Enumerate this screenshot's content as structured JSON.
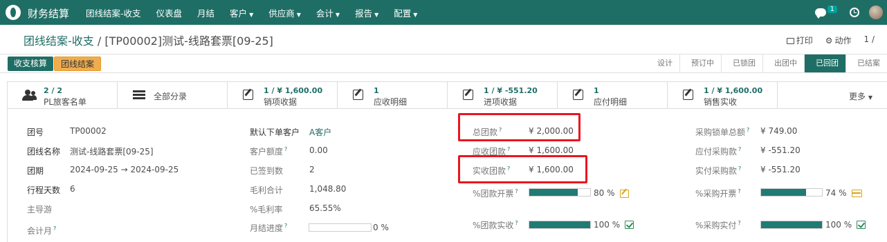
{
  "app": {
    "brand": "财务结算"
  },
  "nav": {
    "items": [
      {
        "label": "团线结案-收支",
        "dropdown": false
      },
      {
        "label": "仪表盘",
        "dropdown": false
      },
      {
        "label": "月结",
        "dropdown": false
      },
      {
        "label": "客户",
        "dropdown": true
      },
      {
        "label": "供应商",
        "dropdown": true
      },
      {
        "label": "会计",
        "dropdown": true
      },
      {
        "label": "报告",
        "dropdown": true
      },
      {
        "label": "配置",
        "dropdown": true
      }
    ],
    "message_count": "1"
  },
  "breadcrumb": {
    "parent": "团线结案-收支",
    "separator": "/",
    "current": "[TP00002]测试-线路套票[09-25]"
  },
  "actions": {
    "print": "打印",
    "action": "动作",
    "pager": "1 /"
  },
  "statusbar": {
    "buttons": [
      "收支核算",
      "团线结案"
    ],
    "stages": [
      "设计",
      "预订中",
      "已锁团",
      "出团中",
      "已回团",
      "已结案"
    ],
    "active_stage": "已回团"
  },
  "smart_buttons": [
    {
      "line1": "2 / 2",
      "line2": "PL旅客名单",
      "icon": "users-icon"
    },
    {
      "line1": "",
      "line2": "全部分录",
      "icon": "list-icon"
    },
    {
      "line1": "1 / ¥ 1,600.00",
      "line2": "销项收据",
      "icon": "edit-icon"
    },
    {
      "line1": "1",
      "line2": "应收明细",
      "icon": "edit-icon"
    },
    {
      "line1": "1 / ¥ -551.20",
      "line2": "进项收据",
      "icon": "edit-icon"
    },
    {
      "line1": "1",
      "line2": "应付明细",
      "icon": "edit-icon"
    },
    {
      "line1": "1 / ¥ 1,600.00",
      "line2": "销售实收",
      "icon": "edit-icon"
    },
    {
      "line1": "",
      "line2": "更多",
      "icon": "caret-down-icon"
    }
  ],
  "col1": {
    "group_no_label": "团号",
    "group_no": "TP00002",
    "group_name_label": "团线名称",
    "group_name": "测试-线路套票[09-25]",
    "period_label": "团期",
    "date_from": "2024-09-25",
    "arrow": "→",
    "date_to": "2024-09-25",
    "days_label": "行程天数",
    "days": "6",
    "guide_label": "主导游",
    "month_label": "会计月"
  },
  "col2": {
    "customer_label": "默认下单客户",
    "customer": "A客户",
    "credit_label": "客户额度",
    "credit": "0.00",
    "signed_label": "已签到数",
    "signed": "2",
    "gross_label": "毛利合计",
    "gross": "1,048.80",
    "margin_label": "%毛利率",
    "margin": "65.55%",
    "month_progress_label": "月结进度",
    "month_progress": "0 %",
    "month_progress_value": 0
  },
  "col3": {
    "total_label": "总团款",
    "total": "¥ 2,000.00",
    "receivable_label": "应收团款",
    "receivable": "¥ 1,600.00",
    "received_label": "实收团款",
    "received": "¥ 1,600.00",
    "invoice_label": "%团款开票",
    "invoice_pct": "80 %",
    "invoice_value": 80,
    "collected_label": "%团款实收",
    "collected_pct": "100 %",
    "collected_value": 100
  },
  "col4": {
    "purchase_total_label": "采购锁单总额",
    "purchase_total": "¥ 749.00",
    "payable_label": "应付采购款",
    "payable": "¥ -551.20",
    "paid_label": "实付采购款",
    "paid": "¥ -551.20",
    "purchase_invoice_label": "%采购开票",
    "purchase_invoice_pct": "74 %",
    "purchase_invoice_value": 74,
    "purchase_paid_label": "%采购实付",
    "purchase_paid_pct": "100 %",
    "purchase_paid_value": 100
  },
  "colors": {
    "primary": "#1f6e66",
    "highlight": "#e8161f",
    "warning": "#f0ad4e"
  }
}
